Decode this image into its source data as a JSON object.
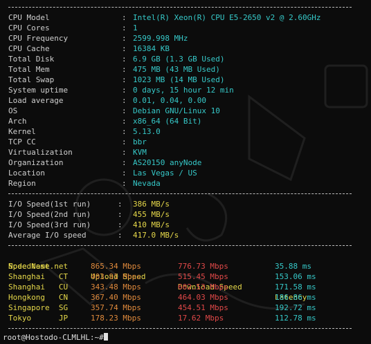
{
  "sysinfo": [
    {
      "key": "CPU Model",
      "value": "Intel(R) Xeon(R) CPU E5-2650 v2 @ 2.60GHz"
    },
    {
      "key": "CPU Cores",
      "value": "1"
    },
    {
      "key": "CPU Frequency",
      "value": "2599.998 MHz"
    },
    {
      "key": "CPU Cache",
      "value": "16384 KB"
    },
    {
      "key": "Total Disk",
      "value": "6.9 GB (1.3 GB Used)"
    },
    {
      "key": "Total Mem",
      "value": "475 MB (43 MB Used)"
    },
    {
      "key": "Total Swap",
      "value": "1023 MB (14 MB Used)"
    },
    {
      "key": "System uptime",
      "value": "0 days, 15 hour 12 min"
    },
    {
      "key": "Load average",
      "value": "0.01, 0.04, 0.00"
    },
    {
      "key": "OS",
      "value": "Debian GNU/Linux 10"
    },
    {
      "key": "Arch",
      "value": "x86_64 (64 Bit)"
    },
    {
      "key": "Kernel",
      "value": "5.13.0"
    },
    {
      "key": "TCP CC",
      "value": "bbr"
    },
    {
      "key": "Virtualization",
      "value": "KVM"
    },
    {
      "key": "Organization",
      "value": "AS20150 anyNode"
    },
    {
      "key": "Location",
      "value": "Las Vegas / US"
    },
    {
      "key": "Region",
      "value": "Nevada"
    }
  ],
  "io": [
    {
      "key": "I/O Speed(1st run)",
      "value": "386 MB/s"
    },
    {
      "key": "I/O Speed(2nd run)",
      "value": "455 MB/s"
    },
    {
      "key": "I/O Speed(3rd run)",
      "value": "410 MB/s"
    },
    {
      "key": "Average I/O speed",
      "value": "417.0 MB/s"
    }
  ],
  "separator": ":",
  "speedtest": {
    "headers": {
      "node": "Node Name",
      "upload": "Upload Speed",
      "download": "Download Speed",
      "latency": "Latency"
    },
    "rows": [
      {
        "node": "Speedtest.net",
        "upload": "865.34 Mbps",
        "download": "776.73 Mbps",
        "latency": "35.88 ms"
      },
      {
        "node": "Shanghai   CT",
        "upload": "403.91 Mbps",
        "download": "515.45 Mbps",
        "latency": "153.06 ms"
      },
      {
        "node": "Shanghai   CU",
        "upload": "343.48 Mbps",
        "download": "602.53 Mbps",
        "latency": "171.58 ms"
      },
      {
        "node": "Hongkong   CN",
        "upload": "367.40 Mbps",
        "download": "464.03 Mbps",
        "latency": "186.86 ms"
      },
      {
        "node": "Singapore  SG",
        "upload": "357.74 Mbps",
        "download": "454.51 Mbps",
        "latency": "192.72 ms"
      },
      {
        "node": "Tokyo      JP",
        "upload": "178.23 Mbps",
        "download": "17.62 Mbps",
        "latency": "112.78 ms"
      }
    ]
  },
  "prompt": "root@Hostodo-CLMLHL:~#",
  "colors": {
    "background": "#0c0c0c",
    "value_cyan": "#36c9c9",
    "value_yellow": "#e6d84a",
    "upload_orange": "#e08a3c",
    "download_red": "#e04848"
  }
}
